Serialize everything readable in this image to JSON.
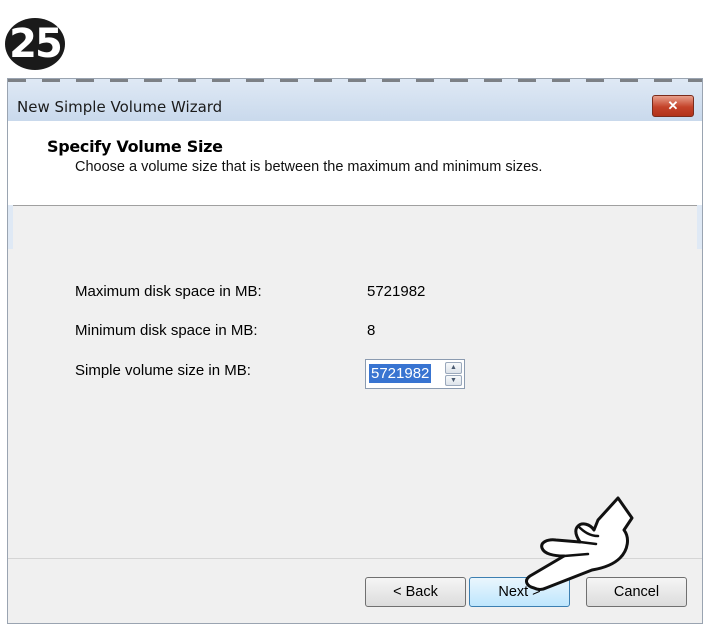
{
  "step_badge": "25",
  "window": {
    "title": "New Simple Volume Wizard",
    "close_label": "✕"
  },
  "header": {
    "title": "Specify Volume Size",
    "subtitle": "Choose a volume size that is between the maximum and minimum sizes."
  },
  "fields": {
    "max_label": "Maximum disk space in MB:",
    "max_value": "5721982",
    "min_label": "Minimum disk space in MB:",
    "min_value": "8",
    "size_label": "Simple volume size in MB:",
    "size_value": "5721982"
  },
  "buttons": {
    "back": "< Back",
    "next": "Next >",
    "cancel": "Cancel"
  },
  "icons": {
    "close": "close-icon",
    "spin_up": "chevron-up-icon",
    "spin_down": "chevron-down-icon",
    "pointer": "pointing-hand-icon"
  }
}
